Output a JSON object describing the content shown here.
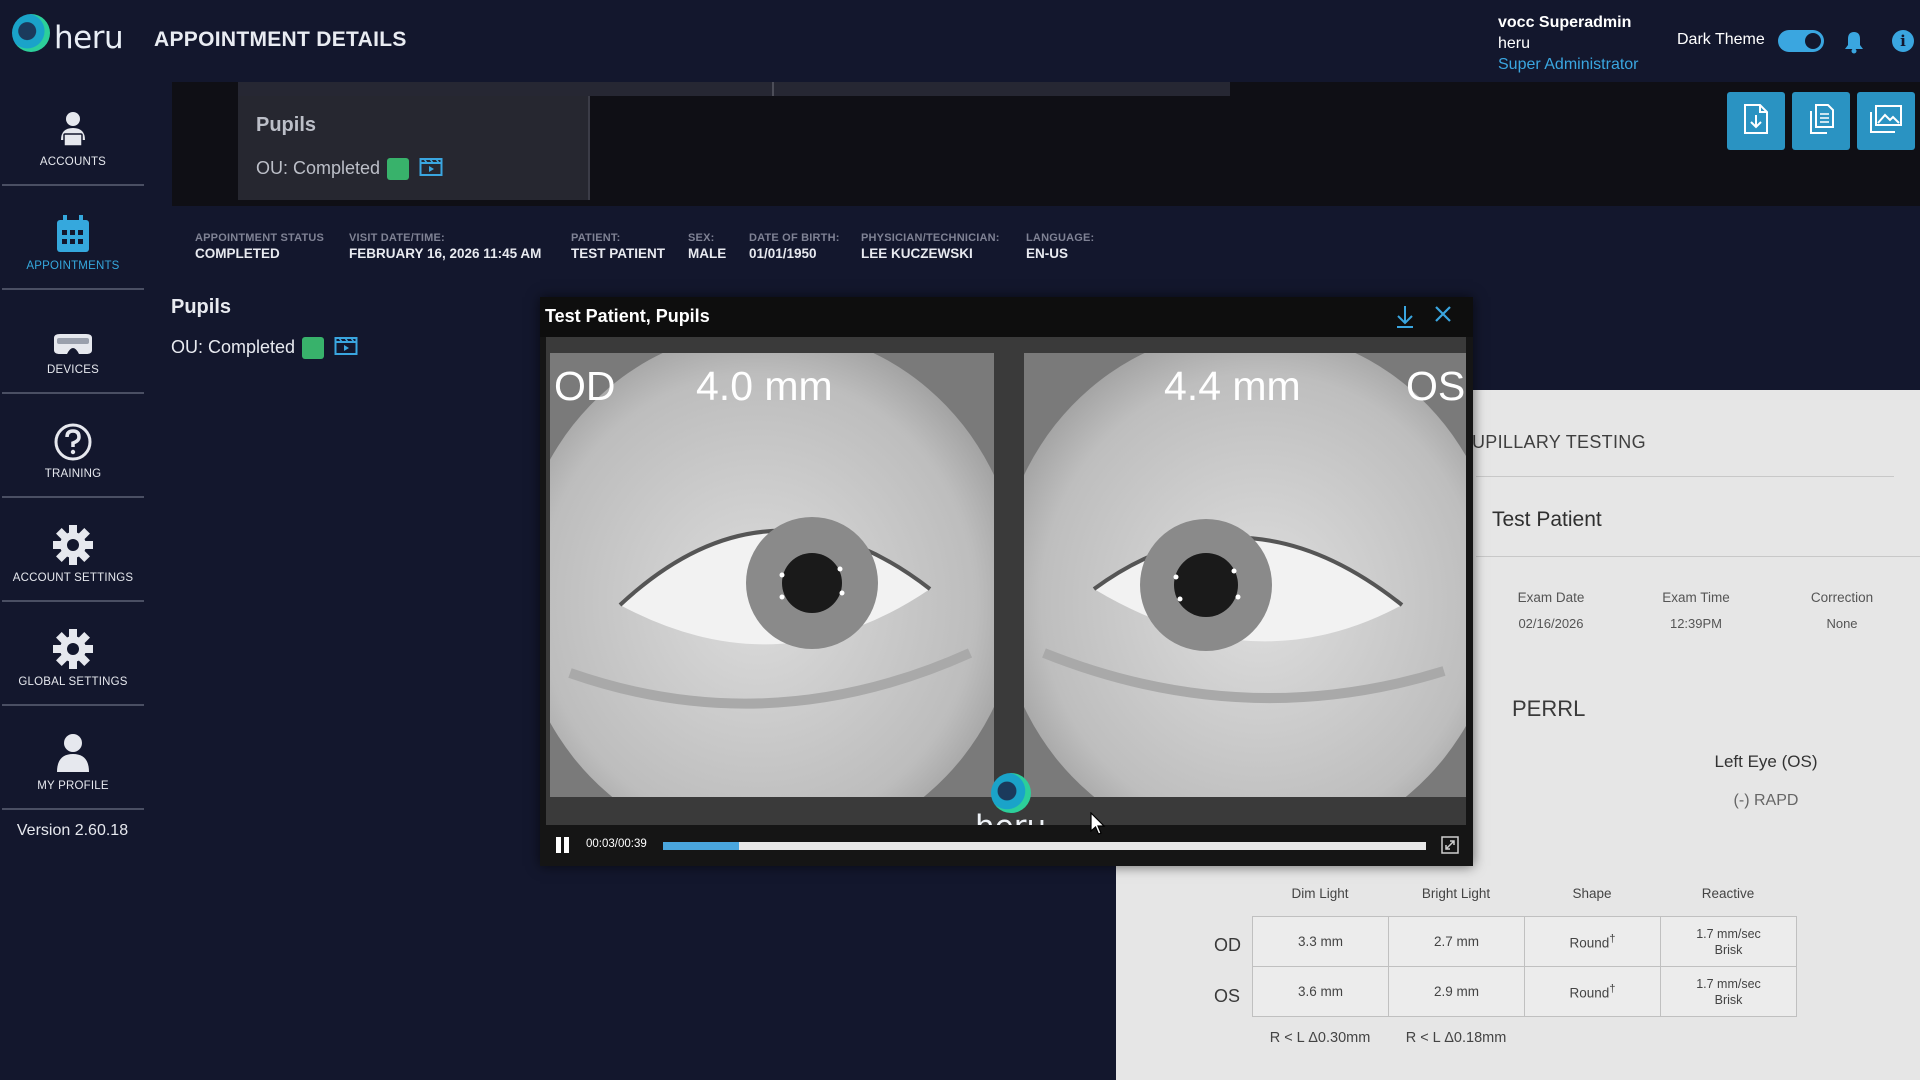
{
  "brand": {
    "logo_text": "heru"
  },
  "sidebar": {
    "items": [
      {
        "label": "ACCOUNTS",
        "icon": "accounts-icon"
      },
      {
        "label": "APPOINTMENTS",
        "icon": "calendar-icon",
        "active": true
      },
      {
        "label": "DEVICES",
        "icon": "headset-icon"
      },
      {
        "label": "TRAINING",
        "icon": "help-icon"
      },
      {
        "label": "ACCOUNT SETTINGS",
        "icon": "gear-icon"
      },
      {
        "label": "GLOBAL SETTINGS",
        "icon": "gear-icon"
      },
      {
        "label": "MY PROFILE",
        "icon": "person-icon"
      }
    ],
    "version": "Version 2.60.18"
  },
  "header": {
    "title": "APPOINTMENT DETAILS",
    "user": {
      "name": "vocc Superadmin",
      "org": "heru",
      "role": "Super Administrator"
    },
    "theme_label": "Dark Theme",
    "dark_theme_on": true
  },
  "test_card": {
    "title": "Pupils",
    "status": "OU: Completed"
  },
  "appointment": {
    "status_label": "APPOINTMENT STATUS",
    "status": "COMPLETED",
    "visit_label": "VISIT DATE/TIME:",
    "visit": "FEBRUARY 16, 2026 11:45 AM",
    "patient_label": "PATIENT:",
    "patient": "TEST PATIENT",
    "sex_label": "SEX:",
    "sex": "MALE",
    "dob_label": "DATE OF BIRTH:",
    "dob": "01/01/1950",
    "physician_label": "PHYSICIAN/TECHNICIAN:",
    "physician": "LEE KUCZEWSKI",
    "language_label": "LANGUAGE:",
    "language": "EN-US"
  },
  "section": {
    "title": "Pupils",
    "status": "OU: Completed"
  },
  "video": {
    "title": "Test Patient, Pupils",
    "od_label": "OD",
    "od_size": "4.0 mm",
    "os_label": "OS",
    "os_size": "4.4 mm",
    "logo_text": "heru",
    "time": "00:03/00:39",
    "progress": 0.1
  },
  "report": {
    "heading": "UPILLARY TESTING",
    "patient": "Test Patient",
    "exam_date_label": "Exam Date",
    "exam_date": "02/16/2026",
    "exam_time_label": "Exam Time",
    "exam_time": "12:39PM",
    "correction_label": "Correction",
    "correction": "None",
    "perrl": "PERRL",
    "left_eye_label": "Left Eye (OS)",
    "left_eye_value": "(-) RAPD",
    "columns": [
      "Dim Light",
      "Bright Light",
      "Shape",
      "Reactive"
    ],
    "rows": [
      {
        "eye": "OD",
        "dim": "3.3 mm",
        "bright": "2.7 mm",
        "shape": "Round",
        "shape_mark": "†",
        "reactive1": "1.7 mm/sec",
        "reactive2": "Brisk"
      },
      {
        "eye": "OS",
        "dim": "3.6 mm",
        "bright": "2.9 mm",
        "shape": "Round",
        "shape_mark": "†",
        "reactive1": "1.7 mm/sec",
        "reactive2": "Brisk"
      }
    ],
    "diff_dim": "R < L  Δ0.30mm",
    "diff_bright": "R < L  Δ0.18mm"
  },
  "colors": {
    "accent": "#3aa6e0",
    "status_green": "#38b26b",
    "background": "#13172d"
  }
}
